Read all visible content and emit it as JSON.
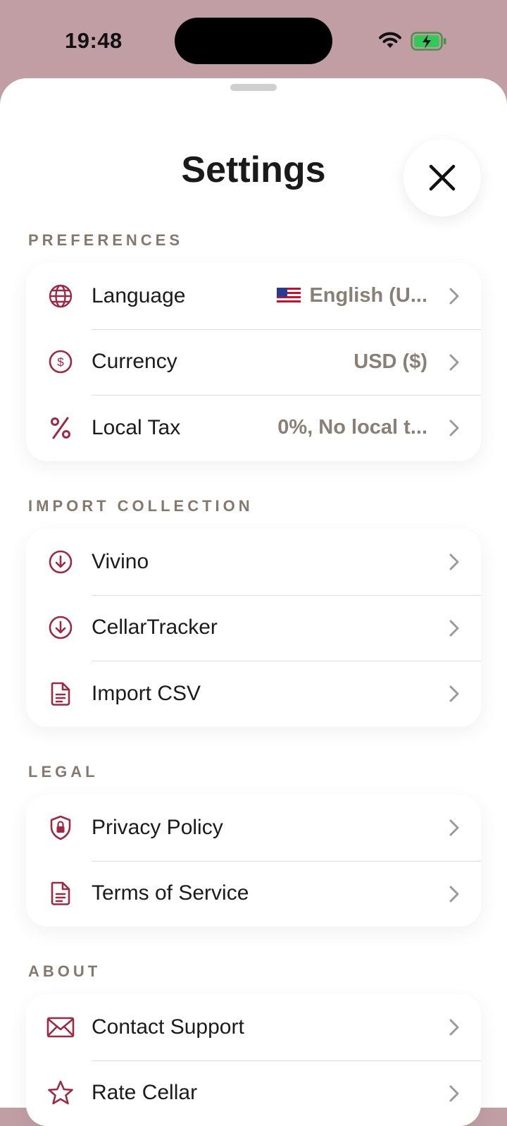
{
  "status_bar": {
    "time": "19:48"
  },
  "sheet": {
    "title": "Settings"
  },
  "sections": {
    "preferences": {
      "header": "PREFERENCES",
      "language": {
        "label": "Language",
        "value": "English (U...",
        "icon": "globe-icon"
      },
      "currency": {
        "label": "Currency",
        "value": "USD ($)",
        "icon": "dollar-circle-icon"
      },
      "tax": {
        "label": "Local Tax",
        "value": "0%, No local t...",
        "icon": "percent-icon"
      }
    },
    "import": {
      "header": "IMPORT COLLECTION",
      "vivino": {
        "label": "Vivino",
        "icon": "download-circle-icon"
      },
      "cellartracker": {
        "label": "CellarTracker",
        "icon": "download-circle-icon"
      },
      "csv": {
        "label": "Import CSV",
        "icon": "document-icon"
      }
    },
    "legal": {
      "header": "LEGAL",
      "privacy": {
        "label": "Privacy Policy",
        "icon": "shield-lock-icon"
      },
      "terms": {
        "label": "Terms of Service",
        "icon": "document-icon"
      }
    },
    "about": {
      "header": "ABOUT",
      "contact": {
        "label": "Contact Support",
        "icon": "envelope-icon"
      },
      "rate": {
        "label": "Rate Cellar",
        "icon": "star-icon"
      }
    }
  },
  "colors": {
    "accent": "#9b2a45",
    "background": "#c09ea4",
    "muted": "#8a7f76"
  }
}
